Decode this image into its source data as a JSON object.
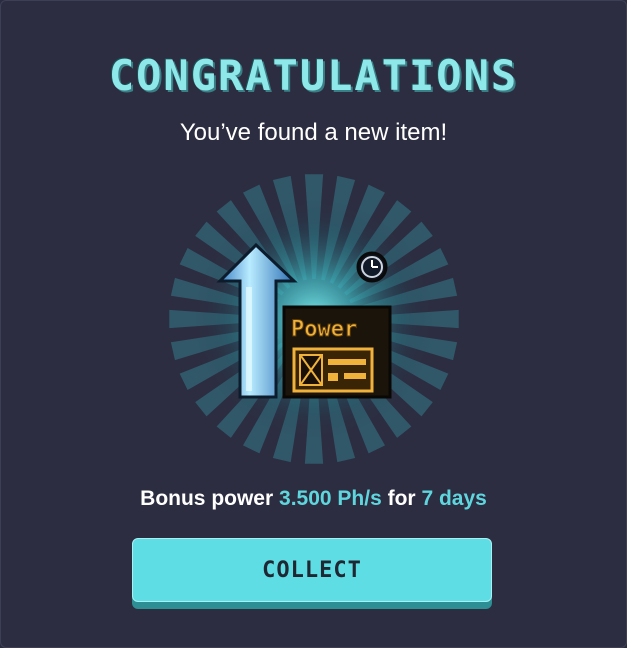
{
  "dialog": {
    "title": "CONGRATULATIONS",
    "subtitle": "You’ve found a new item!",
    "item": {
      "icon": "power-boost-icon",
      "label": "Power"
    },
    "bonus": {
      "prefix": "Bonus power",
      "amount": "3.500 Ph/s",
      "connector": "for",
      "duration": "7 days"
    },
    "collect_label": "COLLECT"
  },
  "colors": {
    "background": "#2c2d41",
    "title": "#8ee8ea",
    "accent": "#5fd6dd",
    "button": "#5fdde4",
    "item_gold": "#f0b23a"
  }
}
